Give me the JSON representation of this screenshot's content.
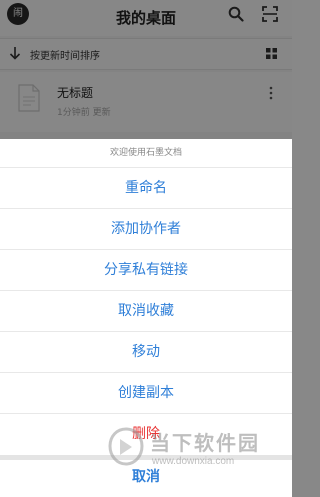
{
  "header": {
    "avatar_char": "闹",
    "title": "我的桌面"
  },
  "sortbar": {
    "label": "按更新时间排序"
  },
  "file": {
    "name": "无标题",
    "meta": "1分钟前 更新"
  },
  "sheet": {
    "header": "欢迎使用石墨文档",
    "actions": [
      "重命名",
      "添加协作者",
      "分享私有链接",
      "取消收藏",
      "移动",
      "创建副本",
      "删除"
    ],
    "cancel": "取消"
  },
  "watermark": {
    "text": "当下软件园",
    "url": "www.downxia.com"
  },
  "colors": {
    "accent": "#2f7fd8",
    "danger": "#e83333"
  }
}
